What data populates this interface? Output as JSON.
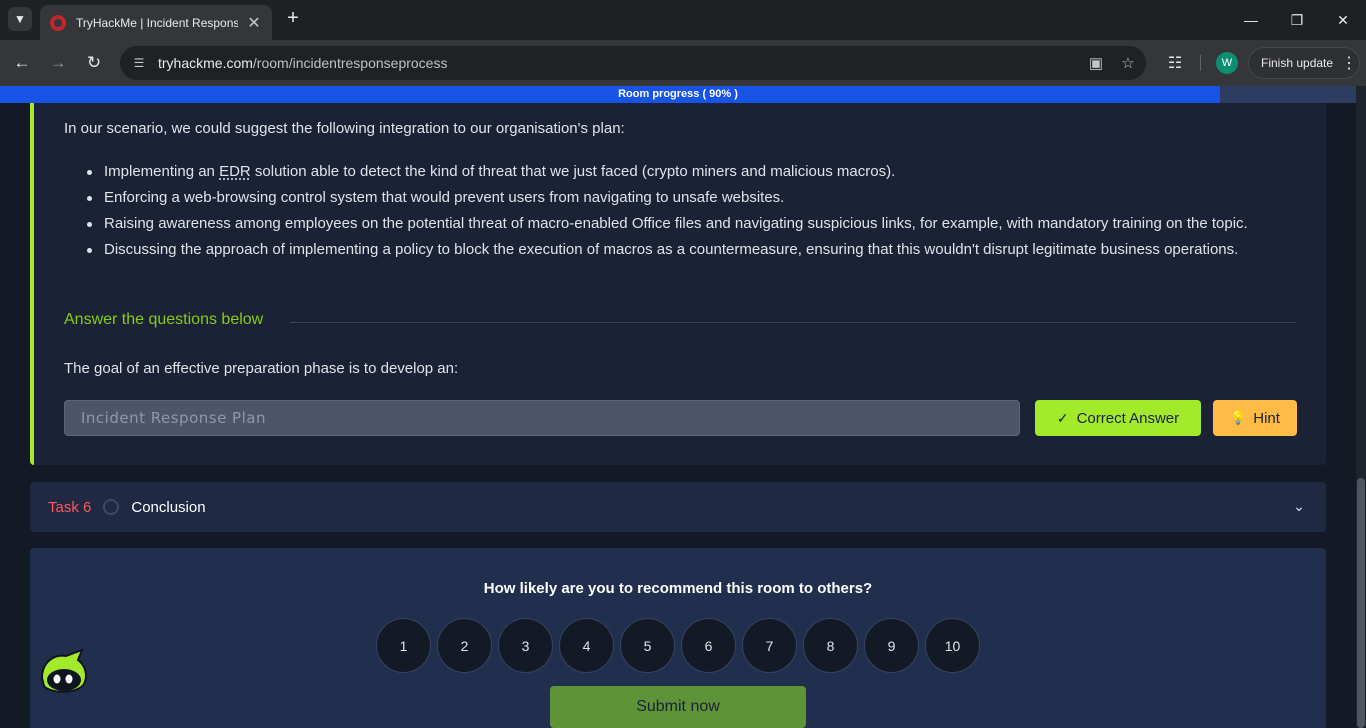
{
  "browser": {
    "tab_title": "TryHackMe | Incident Response",
    "url_host": "tryhackme.com",
    "url_path": "/room/incidentresponseprocess",
    "profile_initial": "W",
    "finish_update_label": "Finish update"
  },
  "progress": {
    "label": "Room progress ( 90% )",
    "value": 0.9
  },
  "task5": {
    "intro": "In our scenario, we could suggest the following integration to our organisation's plan:",
    "bullet1_pre": "Implementing an ",
    "bullet1_abbr": "EDR",
    "bullet1_post": " solution able to detect the kind of threat that we just faced (crypto miners and malicious macros).",
    "bullet2": "Enforcing a web-browsing control system that would prevent users from navigating to unsafe websites.",
    "bullet3": "Raising awareness among employees on the potential threat of macro-enabled Office files and navigating suspicious links, for example, with mandatory training on the topic.",
    "bullet4": "Discussing the approach of implementing a policy to block the execution of macros as a countermeasure, ensuring that this wouldn't disrupt legitimate business operations.",
    "answer_heading": "Answer the questions below",
    "question": "The goal of an effective preparation phase is to develop an:",
    "answer_value": "Incident Response Plan",
    "correct_label": "Correct Answer",
    "hint_label": "Hint"
  },
  "task6": {
    "number": "Task 6",
    "name": "Conclusion"
  },
  "rating": {
    "question": "How likely are you to recommend this room to others?",
    "options": [
      "1",
      "2",
      "3",
      "4",
      "5",
      "6",
      "7",
      "8",
      "9",
      "10"
    ],
    "submit_label": "Submit now"
  },
  "colors": {
    "accent_green": "#a3ea2a",
    "hint_yellow": "#ffbb45",
    "task_red": "#ff575a",
    "progress_blue": "#1754e6"
  }
}
